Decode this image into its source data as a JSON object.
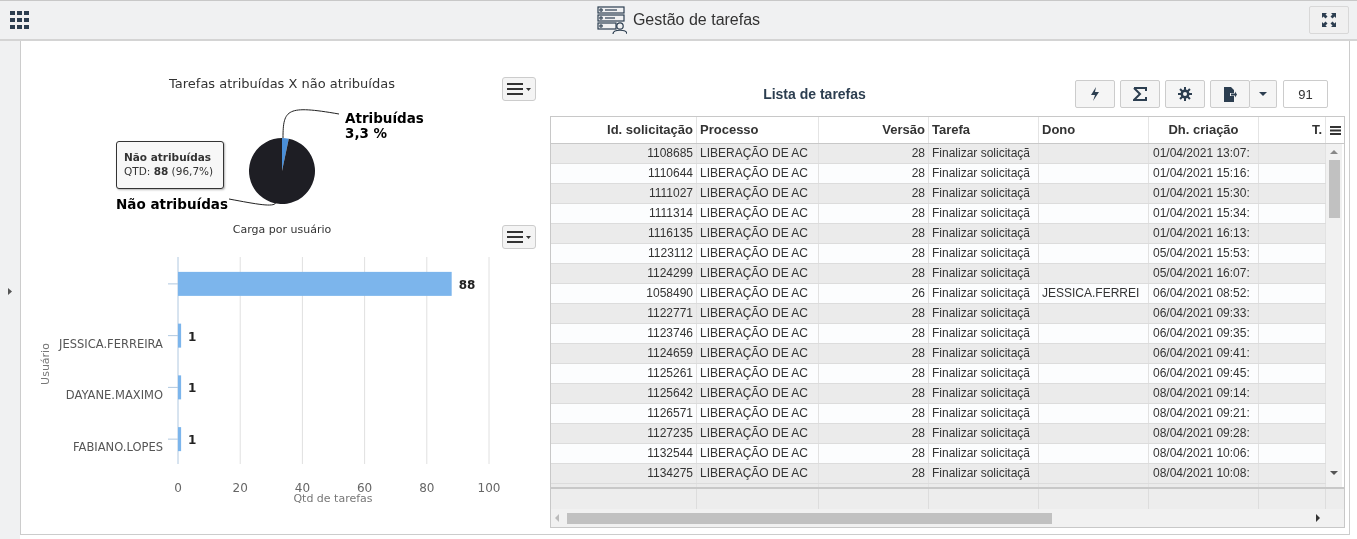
{
  "header": {
    "title": "Gestão de tarefas"
  },
  "pie_chart": {
    "chart_data": {
      "type": "pie",
      "title": "Tarefas atribuídas X não atribuídas",
      "categories": [
        "Atribuídas",
        "Não atribuídas"
      ],
      "values": [
        3.3,
        96.7
      ],
      "colors": [
        "#4a8fd8",
        "#1e1e24"
      ],
      "value_labels": [
        "3,3 %",
        null
      ]
    },
    "tooltip": {
      "title": "Não atribuídas",
      "text": "QTD: **88** (96,7%)"
    }
  },
  "bar_chart": {
    "chart_data": {
      "type": "bar",
      "orientation": "horizontal",
      "title": "Carga por usuário",
      "xlabel": "Qtd de tarefas",
      "ylabel": "Usuário",
      "categories": [
        null,
        "JESSICA.FERREIRA",
        "DAYANE.MAXIMO",
        "FABIANO.LOPES"
      ],
      "values": [
        88,
        1,
        1,
        1
      ],
      "color": "#7cb5ec",
      "xlim": [
        0,
        100
      ],
      "xticks": [
        0,
        20,
        40,
        60,
        80,
        100
      ],
      "grid": true,
      "data_labels": true
    }
  },
  "task_list": {
    "title": "Lista de tarefas",
    "page_size": "91",
    "columns": [
      "Id. solicitação",
      "Processo",
      "Versão",
      "Tarefa",
      "Dono",
      "Dh. criação",
      "T."
    ],
    "rows": [
      [
        "1108685",
        "LIBERAÇÃO DE AC",
        "28",
        "Finalizar solicitaçã",
        null,
        "01/04/2021 13:07:"
      ],
      [
        "1110644",
        "LIBERAÇÃO DE AC",
        "28",
        "Finalizar solicitaçã",
        null,
        "01/04/2021 15:16:"
      ],
      [
        "1111027",
        "LIBERAÇÃO DE AC",
        "28",
        "Finalizar solicitaçã",
        null,
        "01/04/2021 15:30:"
      ],
      [
        "1111314",
        "LIBERAÇÃO DE AC",
        "28",
        "Finalizar solicitaçã",
        null,
        "01/04/2021 15:34:"
      ],
      [
        "1116135",
        "LIBERAÇÃO DE AC",
        "28",
        "Finalizar solicitaçã",
        null,
        "01/04/2021 16:13:"
      ],
      [
        "1123112",
        "LIBERAÇÃO DE AC",
        "28",
        "Finalizar solicitaçã",
        null,
        "05/04/2021 15:53:"
      ],
      [
        "1124299",
        "LIBERAÇÃO DE AC",
        "28",
        "Finalizar solicitaçã",
        null,
        "05/04/2021 16:07:"
      ],
      [
        "1058490",
        "LIBERAÇÃO DE AC",
        "26",
        "Finalizar solicitaçã",
        "JESSICA.FERREI",
        "06/04/2021 08:52:"
      ],
      [
        "1122771",
        "LIBERAÇÃO DE AC",
        "28",
        "Finalizar solicitaçã",
        null,
        "06/04/2021 09:33:"
      ],
      [
        "1123746",
        "LIBERAÇÃO DE AC",
        "28",
        "Finalizar solicitaçã",
        null,
        "06/04/2021 09:35:"
      ],
      [
        "1124659",
        "LIBERAÇÃO DE AC",
        "28",
        "Finalizar solicitaçã",
        null,
        "06/04/2021 09:41:"
      ],
      [
        "1125261",
        "LIBERAÇÃO DE AC",
        "28",
        "Finalizar solicitaçã",
        null,
        "06/04/2021 09:45:"
      ],
      [
        "1125642",
        "LIBERAÇÃO DE AC",
        "28",
        "Finalizar solicitaçã",
        null,
        "08/04/2021 09:14:"
      ],
      [
        "1126571",
        "LIBERAÇÃO DE AC",
        "28",
        "Finalizar solicitaçã",
        null,
        "08/04/2021 09:21:"
      ],
      [
        "1127235",
        "LIBERAÇÃO DE AC",
        "28",
        "Finalizar solicitaçã",
        null,
        "08/04/2021 09:28:"
      ],
      [
        "1132544",
        "LIBERAÇÃO DE AC",
        "28",
        "Finalizar solicitaçã",
        null,
        "08/04/2021 10:06:"
      ],
      [
        "1134275",
        "LIBERAÇÃO DE AC",
        "28",
        "Finalizar solicitaçã",
        null,
        "08/04/2021 10:08:"
      ]
    ]
  }
}
